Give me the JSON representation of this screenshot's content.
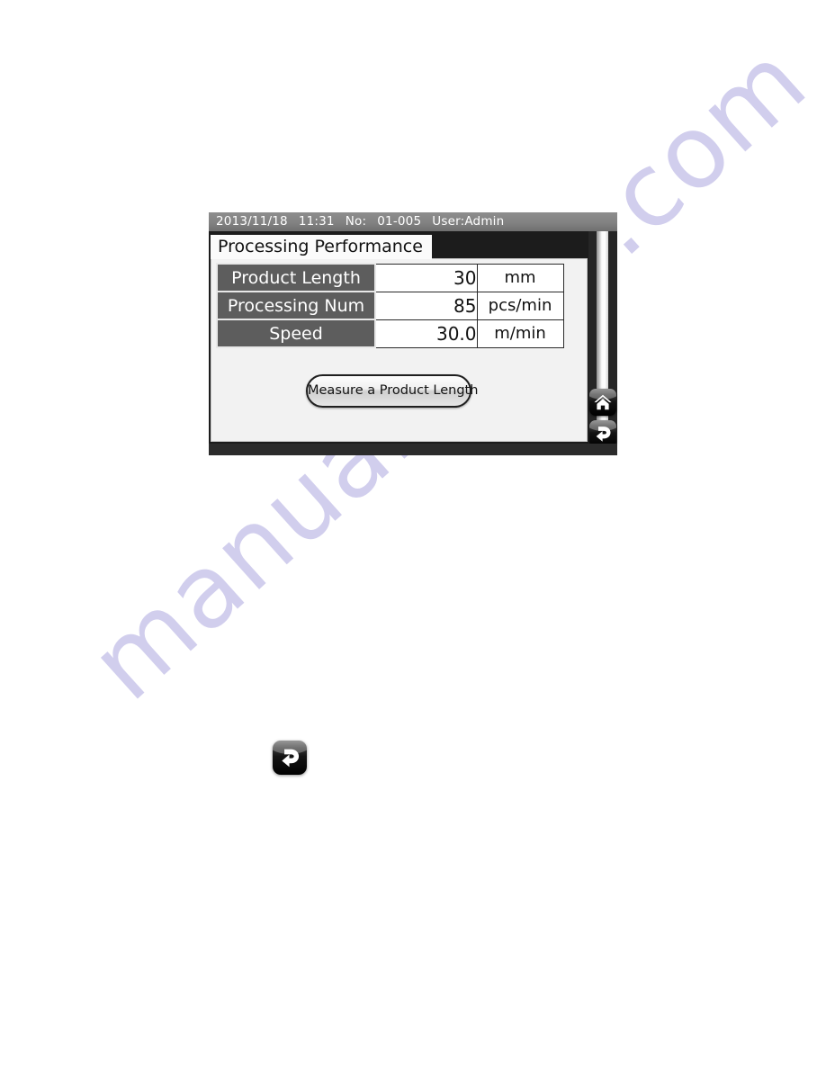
{
  "watermark": {
    "text": "manualshive.com",
    "color": "#c9c6ea"
  },
  "device": {
    "status_bar": {
      "date": "2013/11/18",
      "time": "11:31",
      "number_label": "No:",
      "number_value": "01-005",
      "user_label": "User:Admin"
    },
    "screen_title": "Processing Performance",
    "table": {
      "rows": [
        {
          "label": "Product Length",
          "value": "30",
          "unit": "mm"
        },
        {
          "label": "Processing Num",
          "value": "85",
          "unit": "pcs/min"
        },
        {
          "label": "Speed",
          "value": "30.0",
          "unit": "m/min"
        }
      ]
    },
    "measure_button_label": "Measure a Product Length",
    "rail": {
      "home_icon": "home-icon",
      "return_icon": "return-arrow-icon"
    }
  },
  "body_icon": {
    "name": "return-arrow-icon"
  },
  "colors": {
    "status_bar": "#828282",
    "label_cell": "#5d5d5d",
    "screen_bg": "#1c1c1c",
    "content_bg": "#f2f2f2"
  }
}
